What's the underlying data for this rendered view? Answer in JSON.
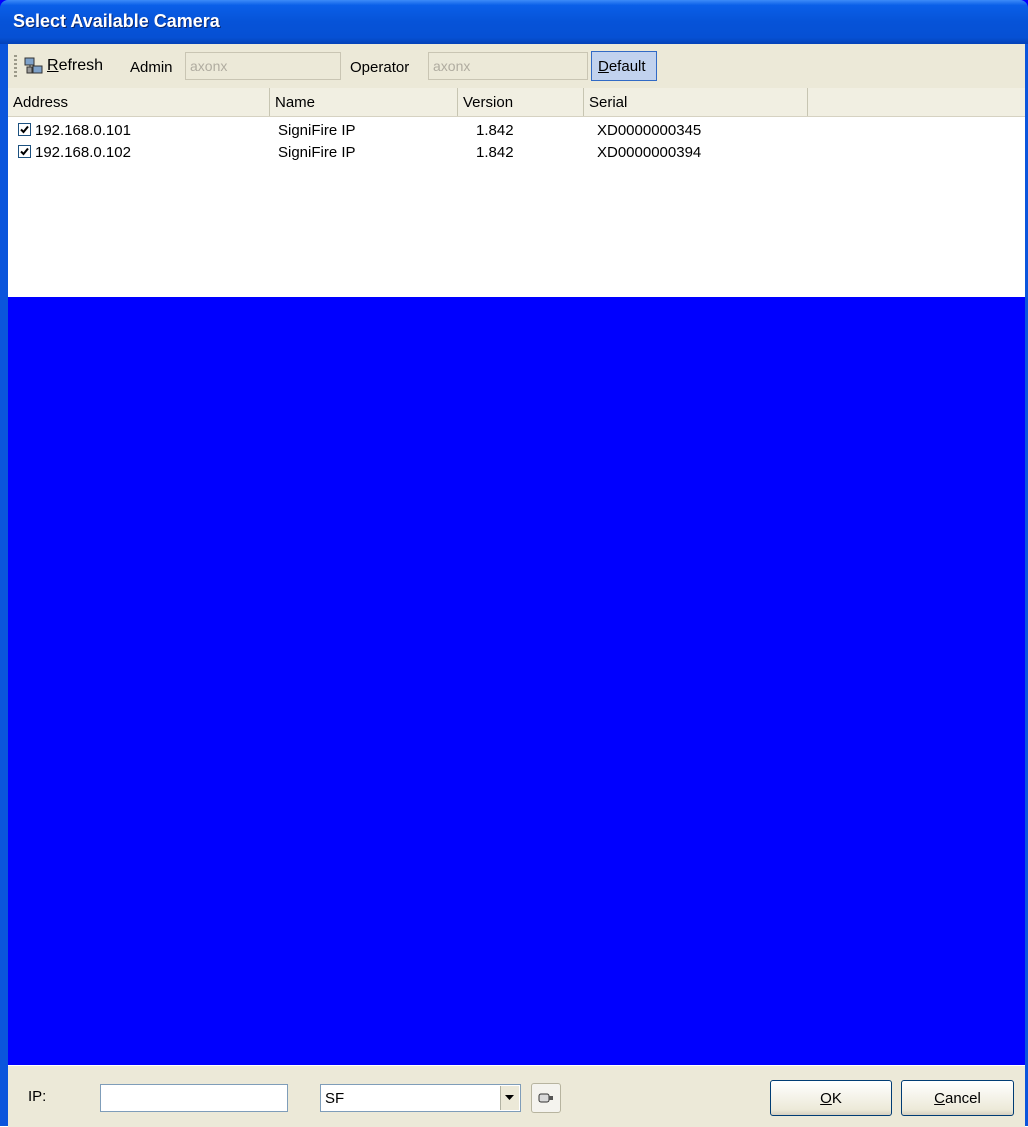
{
  "window": {
    "title": "Select Available Camera"
  },
  "toolbar": {
    "refresh_label": "Refresh",
    "refresh_mnemonic": "R",
    "refresh_rest": "efresh",
    "admin_label": "Admin",
    "admin_value": "axonx",
    "operator_label": "Operator",
    "operator_value": "axonx",
    "default_mnemonic": "D",
    "default_rest": "efault"
  },
  "list": {
    "columns": [
      "Address",
      "Name",
      "Version",
      "Serial"
    ],
    "rows": [
      {
        "checked": true,
        "address": "192.168.0.101",
        "name": "SigniFire IP",
        "version": "1.842",
        "serial": "XD0000000345"
      },
      {
        "checked": true,
        "address": "192.168.0.102",
        "name": "SigniFire IP",
        "version": "1.842",
        "serial": "XD0000000394"
      }
    ]
  },
  "bottom": {
    "ip_label": "IP:",
    "ip_value": "",
    "type_value": "SF",
    "ok_mnemonic": "O",
    "ok_rest": "K",
    "cancel_mnemonic": "C",
    "cancel_rest": "ancel"
  },
  "colors": {
    "accent": "#0000ff",
    "titlebar": "#0653d8"
  },
  "icons": {
    "refresh": "network-refresh-icon",
    "camera": "camera-icon",
    "dropdown": "chevron-down-icon"
  }
}
